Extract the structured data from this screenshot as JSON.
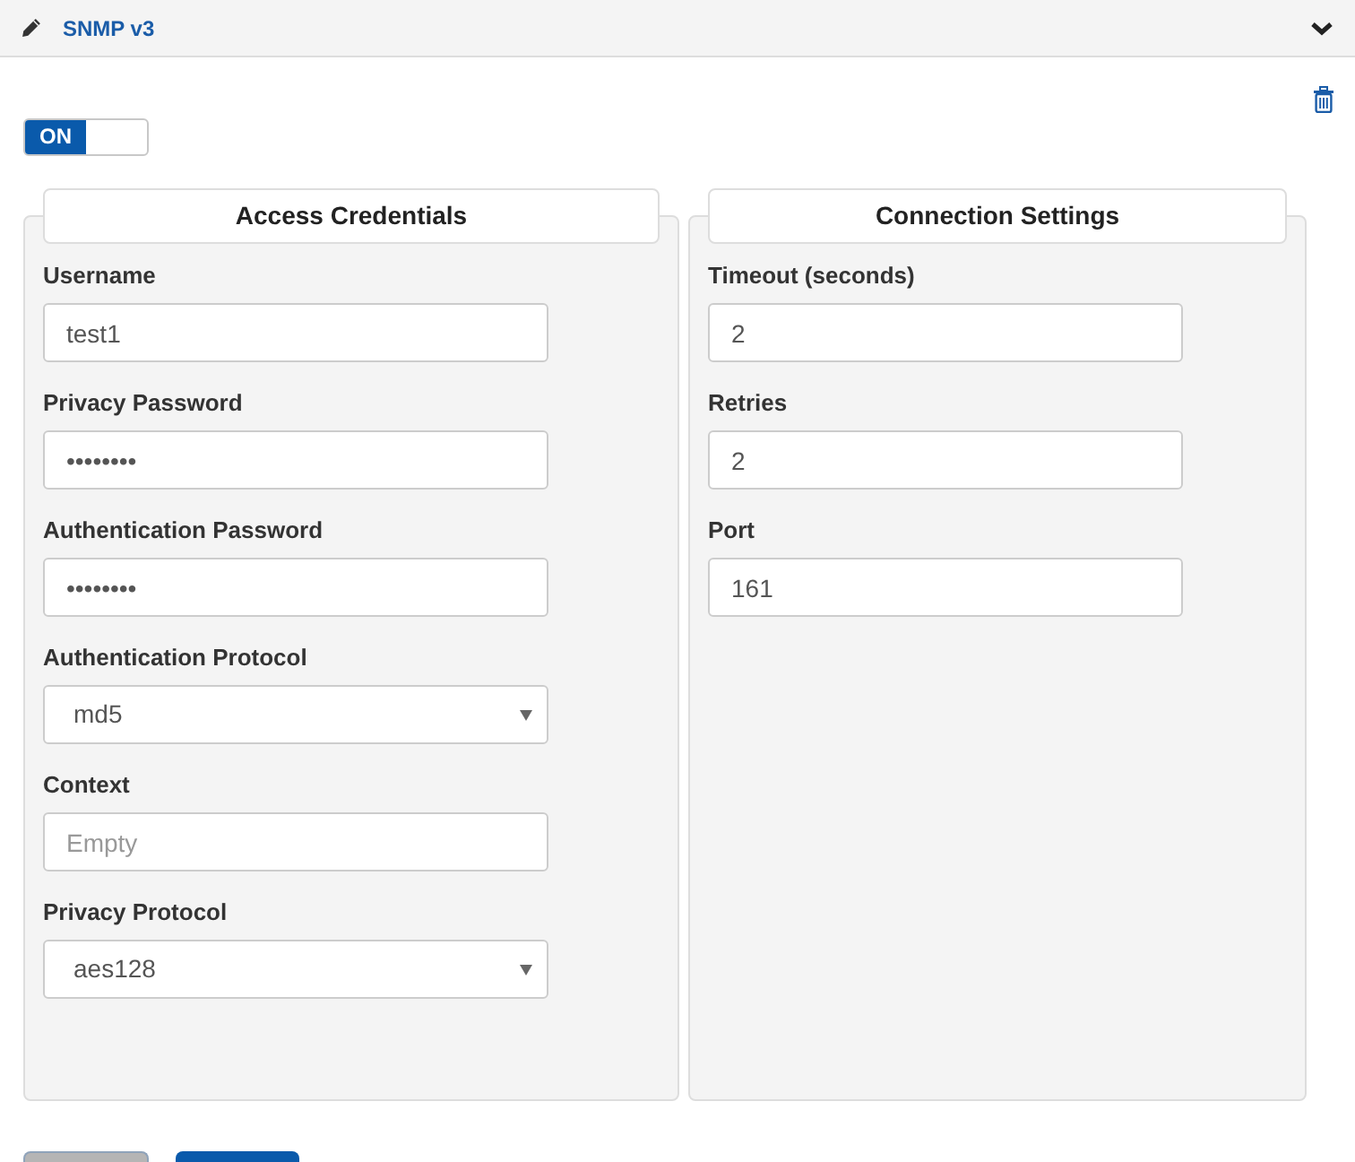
{
  "panel": {
    "title": "SNMP v3"
  },
  "enabled_toggle": {
    "label": "ON",
    "on": true
  },
  "sections": [
    {
      "title": "Access Credentials",
      "fields": [
        {
          "kind": "text",
          "label": "Username",
          "value": "test1"
        },
        {
          "kind": "password",
          "label": "Privacy Password",
          "value": "••••••••"
        },
        {
          "kind": "password",
          "label": "Authentication Password",
          "value": "••••••••"
        },
        {
          "kind": "select",
          "label": "Authentication Protocol",
          "value": "md5"
        },
        {
          "kind": "text",
          "label": "Context",
          "placeholder": "Empty"
        },
        {
          "kind": "select",
          "label": "Privacy Protocol",
          "value": "aes128"
        }
      ]
    },
    {
      "title": "Connection Settings",
      "fields": [
        {
          "kind": "text",
          "label": "Timeout (seconds)",
          "value": "2"
        },
        {
          "kind": "text",
          "label": "Retries",
          "value": "2"
        },
        {
          "kind": "text",
          "label": "Port",
          "value": "161"
        }
      ]
    }
  ],
  "footer_buttons": [
    {
      "kind": "secondary"
    },
    {
      "kind": "primary"
    }
  ]
}
